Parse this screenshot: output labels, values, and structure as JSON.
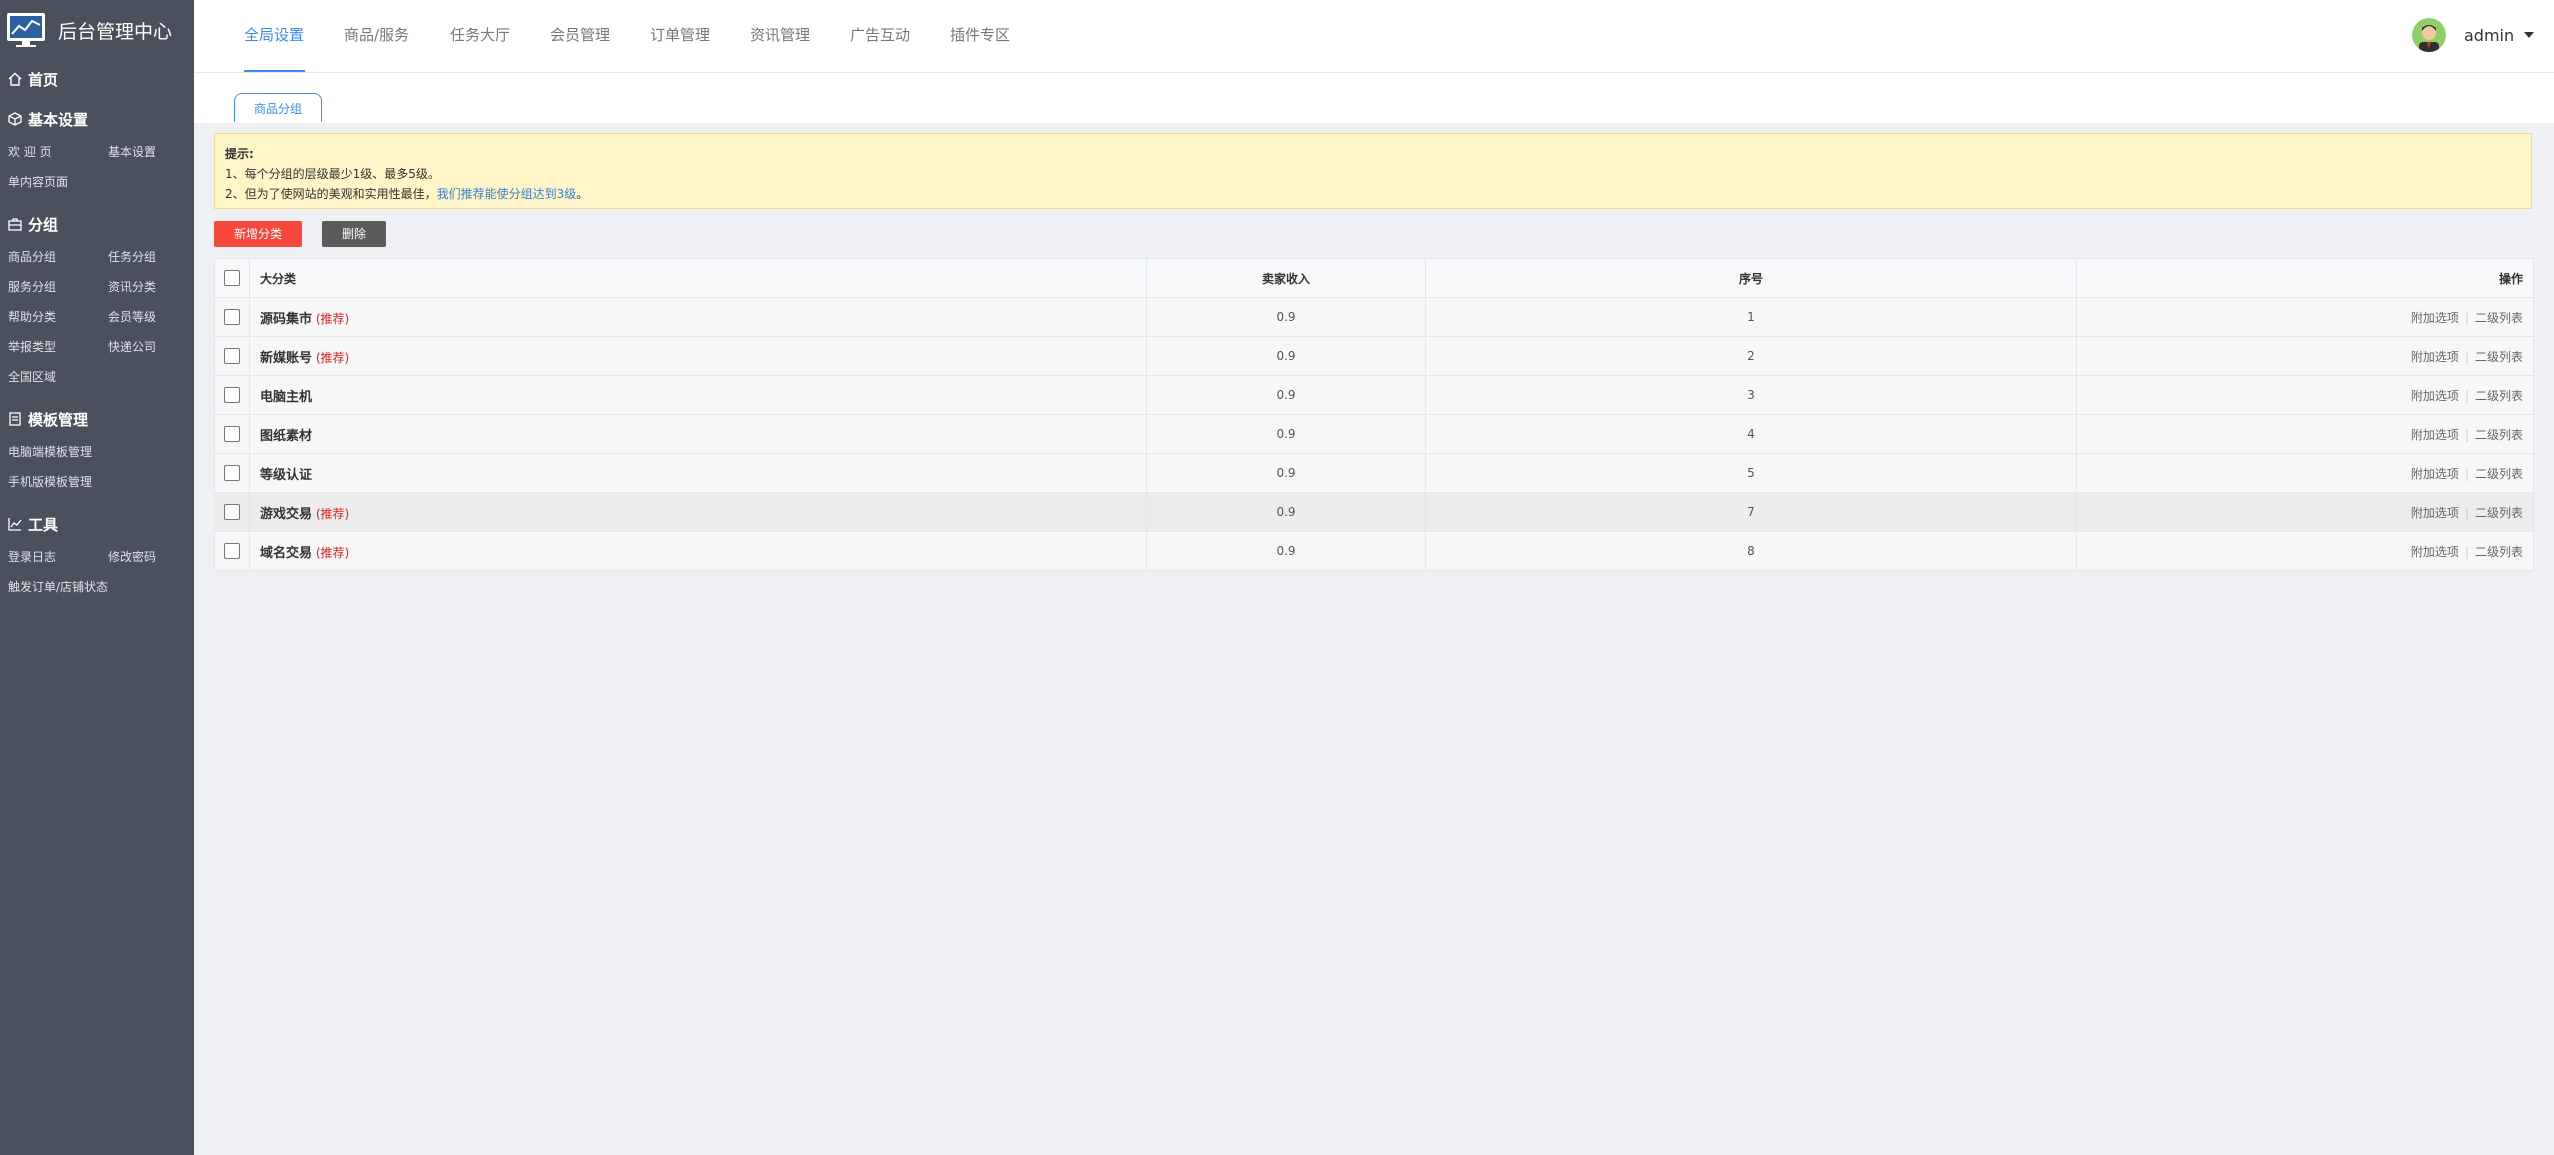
{
  "app": {
    "title": "后台管理中心"
  },
  "sidebar": {
    "sections": [
      {
        "label": "首页",
        "icon": "home-icon",
        "items": []
      },
      {
        "label": "基本设置",
        "icon": "cube-icon",
        "items": [
          "欢 迎 页",
          "基本设置",
          "单内容页面"
        ]
      },
      {
        "label": "分组",
        "icon": "briefcase-icon",
        "items": [
          "商品分组",
          "任务分组",
          "服务分组",
          "资讯分类",
          "帮助分类",
          "会员等级",
          "举报类型",
          "快递公司",
          "全国区域"
        ]
      },
      {
        "label": "模板管理",
        "icon": "document-icon",
        "items": [
          "电脑端模板管理",
          "手机版模板管理"
        ]
      },
      {
        "label": "工具",
        "icon": "chart-line-icon",
        "items": [
          "登录日志",
          "修改密码",
          "触发订单/店铺状态"
        ]
      }
    ]
  },
  "topnav": {
    "items": [
      "全局设置",
      "商品/服务",
      "任务大厅",
      "会员管理",
      "订单管理",
      "资讯管理",
      "广告互动",
      "插件专区"
    ],
    "active": "全局设置"
  },
  "user": {
    "name": "admin"
  },
  "subtab": {
    "label": "商品分组"
  },
  "tips": {
    "title": "提示:",
    "line1": "1、每个分组的层级最少1级、最多5级。",
    "line2_prefix": "2、但为了使网站的美观和实用性最佳，",
    "line2_link": "我们推荐能使分组达到3级",
    "line2_suffix": "。"
  },
  "buttons": {
    "add": "新增分类",
    "delete": "删除"
  },
  "table": {
    "headers": {
      "name": "大分类",
      "income": "卖家收入",
      "seq": "序号",
      "ops": "操作"
    },
    "op_labels": {
      "extra": "附加选项",
      "sub": "二级列表"
    },
    "recommend_label": "(推荐)",
    "rows": [
      {
        "name": "源码集市",
        "recommended": true,
        "income": "0.9",
        "seq": "1"
      },
      {
        "name": "新媒账号",
        "recommended": true,
        "income": "0.9",
        "seq": "2"
      },
      {
        "name": "电脑主机",
        "recommended": false,
        "income": "0.9",
        "seq": "3"
      },
      {
        "name": "图纸素材",
        "recommended": false,
        "income": "0.9",
        "seq": "4"
      },
      {
        "name": "等级认证",
        "recommended": false,
        "income": "0.9",
        "seq": "5"
      },
      {
        "name": "游戏交易",
        "recommended": true,
        "income": "0.9",
        "seq": "7"
      },
      {
        "name": "域名交易",
        "recommended": true,
        "income": "0.9",
        "seq": "8"
      }
    ]
  },
  "colors": {
    "accent": "#3b8cf0",
    "danger": "#f5483b",
    "sidebar": "#4a505c"
  }
}
